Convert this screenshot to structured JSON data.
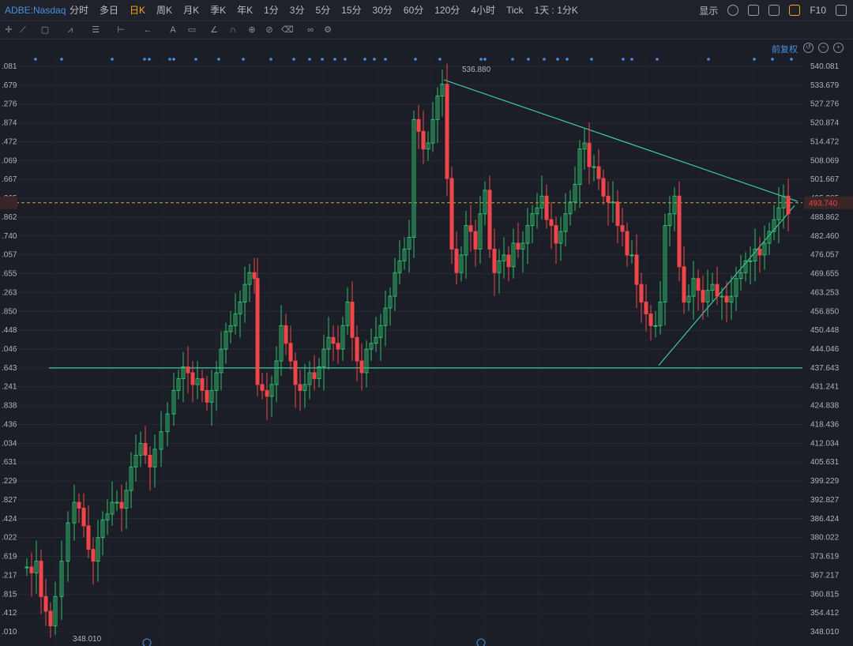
{
  "topbar": {
    "symbol": "ADBE:Nasdaq",
    "periods": [
      "分时",
      "多日",
      "日K",
      "周K",
      "月K",
      "季K",
      "年K",
      "1分",
      "3分",
      "5分",
      "15分",
      "30分",
      "60分",
      "120分",
      "4小时",
      "Tick",
      "1天 : 1分K"
    ],
    "active_period": "日K",
    "display_label": "显示",
    "f10_label": "F10"
  },
  "subbar": {
    "adjust_label": "前复权"
  },
  "chart_data": {
    "type": "candlestick",
    "y_ticks": [
      "540.081",
      "533.679",
      "527.276",
      "520.874",
      "514.472",
      "508.069",
      "501.667",
      "495.265",
      "488.862",
      "482.460",
      "476.057",
      "469.655",
      "463.253",
      "456.850",
      "450.448",
      "444.046",
      "437.643",
      "431.241",
      "424.838",
      "418.436",
      "412.034",
      "405.631",
      "399.229",
      "392.827",
      "386.424",
      "380.022",
      "373.619",
      "367.217",
      "360.815",
      "354.412",
      "348.010"
    ],
    "left_ticks": [
      ".081",
      ".679",
      ".276",
      ".874",
      ".472",
      ".069",
      ".667",
      ".265",
      ".862",
      ".740",
      ".057",
      ".655",
      ".263",
      ".850",
      ".448",
      ".046",
      ".643",
      ".241",
      ".838",
      ".436",
      ".034",
      ".631",
      ".229",
      ".827",
      ".424",
      ".022",
      ".619",
      ".217",
      ".815",
      ".412",
      ".010"
    ],
    "ylim": [
      348.01,
      540.081
    ],
    "current_price": "493.740",
    "high_label": "536.880",
    "low_label": "348.010",
    "support_level": 437.643,
    "colors": {
      "up": "#2dbd6e",
      "down": "#f0454a",
      "trend": "#3fc9a8",
      "support": "#46c8a0",
      "current": "#c8a54a"
    }
  }
}
